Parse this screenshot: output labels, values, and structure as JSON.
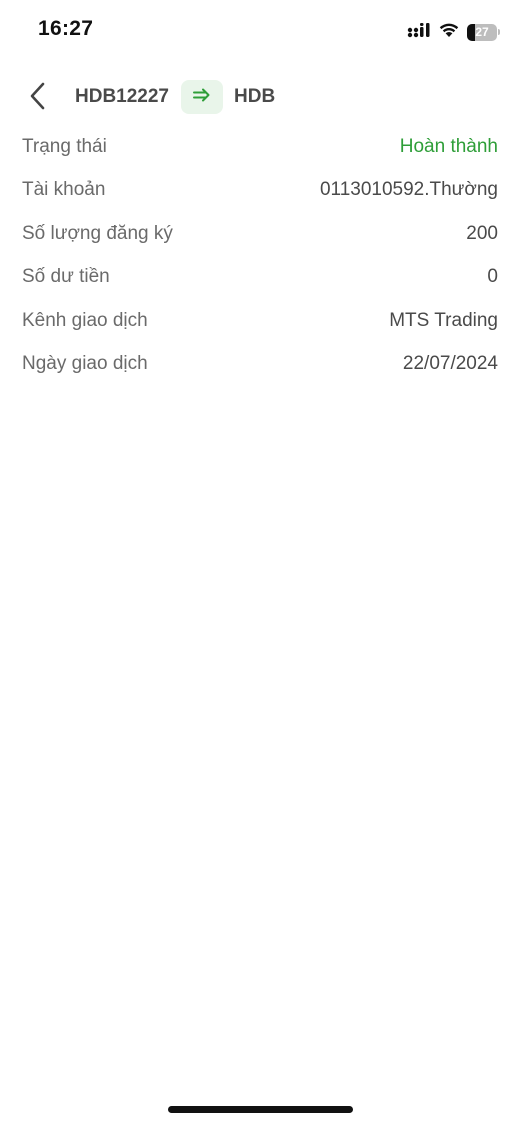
{
  "status_bar": {
    "time": "16:27",
    "battery_level": "27",
    "icons": [
      "cellular-signal-icon",
      "wifi-icon",
      "battery-icon"
    ]
  },
  "header": {
    "from_symbol": "HDB12227",
    "to_symbol": "HDB",
    "back_icon": "chevron-left-icon",
    "transfer_icon": "arrow-right-icon"
  },
  "details": [
    {
      "label": "Trạng thái",
      "value": "Hoàn thành"
    },
    {
      "label": "Tài khoản",
      "value": "0113010592.Thường"
    },
    {
      "label": "Số lượng đăng ký",
      "value": "200"
    },
    {
      "label": "Số dư tiền",
      "value": "0"
    },
    {
      "label": "Kênh giao dịch",
      "value": "MTS Trading"
    },
    {
      "label": "Ngày giao dịch",
      "value": "22/07/2024"
    }
  ],
  "colors": {
    "status_complete": "#2e9e38",
    "arrow_chip_bg": "#e9f5ea",
    "text_primary": "#4a4a4a",
    "text_label": "#6a6a6a"
  }
}
